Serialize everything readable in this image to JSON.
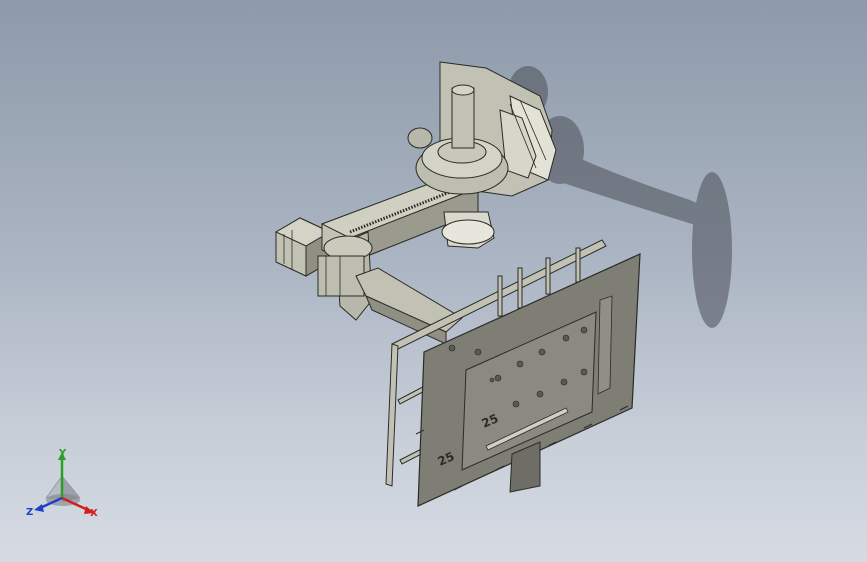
{
  "viewport": {
    "background_top": "#8e9aaa",
    "background_bottom": "#d6dbe3",
    "model_face_color": "#c2c2b4",
    "model_shade_color": "#8f8f83",
    "model_edge_color": "#2b2b28",
    "shadow_color": "#4a4f57"
  },
  "plate": {
    "marking_top": "25",
    "marking_bottom": "25"
  },
  "triad": {
    "x_label": "X",
    "y_label": "Y",
    "z_label": "Z",
    "x_color": "#d21e1e",
    "y_color": "#2aa02a",
    "z_color": "#2040c8"
  }
}
